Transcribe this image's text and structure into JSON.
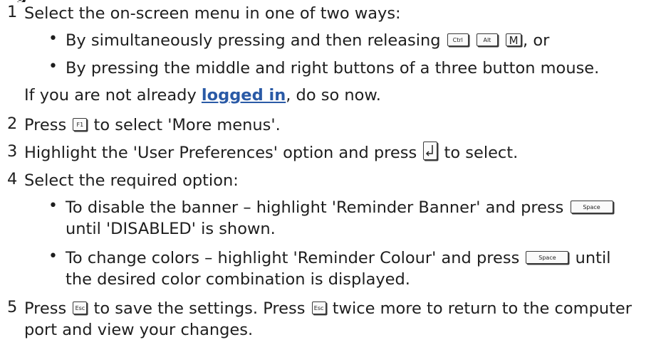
{
  "heading_fragment": "g",
  "steps": [
    {
      "number": "1",
      "text": "Select the on-screen menu in one of two ways:",
      "bullets": [
        {
          "before": "By simultaneously pressing and then releasing",
          "keys": [
            "Ctrl",
            "Alt",
            "M"
          ],
          "after": ", or"
        },
        {
          "text": "By pressing the middle and right buttons of a three button mouse."
        }
      ],
      "note_before": "If you are not already ",
      "note_link": "logged in",
      "note_after": ", do so now."
    },
    {
      "number": "2",
      "before": "Press",
      "key": "F1",
      "after": "to select 'More menus'."
    },
    {
      "number": "3",
      "before": "Highlight the 'User Preferences' option and press",
      "key_icon": "enter-key-icon",
      "after": "to select."
    },
    {
      "number": "4",
      "text": "Select the required option:",
      "bullets": [
        {
          "before": "To disable the banner – highlight 'Reminder Banner' and press",
          "key": "Space",
          "line2": "until 'DISABLED' is shown."
        },
        {
          "before": "To change colors – highlight 'Reminder Colour' and press",
          "key": "Space",
          "after": "until",
          "line2": "the desired color combination is displayed."
        }
      ]
    },
    {
      "number": "5",
      "before": "Press",
      "key": "Esc",
      "middle": "to save the settings. Press",
      "key2": "Esc",
      "after": "twice more to return to the computer",
      "line2": "port and view your changes."
    }
  ],
  "colors": {
    "text": "#1e1e1e",
    "link": "#2a5aa6"
  }
}
